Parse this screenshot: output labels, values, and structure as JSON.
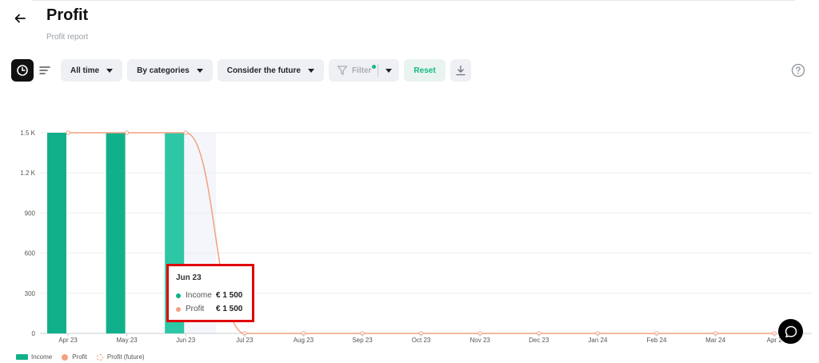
{
  "header": {
    "title": "Profit",
    "subtitle": "Profit report"
  },
  "toolbar": {
    "period": "All time",
    "grouping": "By categories",
    "future": "Consider the future",
    "filter": "Filter",
    "reset": "Reset"
  },
  "icons": {
    "back": "arrow-left-icon",
    "chart_view": "pie-chart-icon",
    "list_view": "list-lines-icon",
    "filter": "funnel-icon",
    "download": "download-icon",
    "help": "question-circle-icon",
    "chat": "chat-bubble-icon"
  },
  "colors": {
    "income": "#12b08a",
    "income_highlight": "#2ec7a6",
    "profit": "#f4a07f",
    "accent": "#12b886",
    "tooltip_border": "#e00000"
  },
  "tooltip": {
    "title": "Jun 23",
    "rows": [
      {
        "label": "Income",
        "value": "€ 1 500"
      },
      {
        "label": "Profit",
        "value": "€ 1 500"
      }
    ]
  },
  "chart_data": {
    "type": "bar",
    "categories": [
      "Apr 23",
      "May 23",
      "Jun 23",
      "Jul 23",
      "Aug 23",
      "Sep 23",
      "Oct 23",
      "Nov 23",
      "Dec 23",
      "Jan 24",
      "Feb 24",
      "Mar 24",
      "Apr 24"
    ],
    "category_labels": [
      "Apr 23",
      "May 23",
      "Jun 23",
      "Jul 23",
      "Aug 23",
      "Sep 23",
      "Oct 23",
      "Nov 23",
      "Dec 23",
      "Jan 24",
      "Feb 24",
      "Mar 24",
      "Apr 2"
    ],
    "series": [
      {
        "name": "Income",
        "type": "bar",
        "values": [
          1500,
          1500,
          1500,
          0,
          0,
          0,
          0,
          0,
          0,
          0,
          0,
          0,
          0
        ]
      },
      {
        "name": "Profit",
        "type": "line",
        "values": [
          1500,
          1500,
          1500,
          0,
          0,
          0,
          0,
          0,
          0,
          0,
          0,
          0,
          0
        ]
      }
    ],
    "legend": [
      "Income",
      "Profit",
      "Profit (future)"
    ],
    "legend_position": "bottom-left",
    "y_ticks": [
      {
        "value": 0,
        "label": "0"
      },
      {
        "value": 300,
        "label": "300"
      },
      {
        "value": 600,
        "label": "600"
      },
      {
        "value": 900,
        "label": "900"
      },
      {
        "value": 1200,
        "label": "1.2 K"
      },
      {
        "value": 1500,
        "label": "1.5 K"
      }
    ],
    "ylim": [
      0,
      1500
    ],
    "highlighted_category": "Jun 23",
    "grid": true
  }
}
